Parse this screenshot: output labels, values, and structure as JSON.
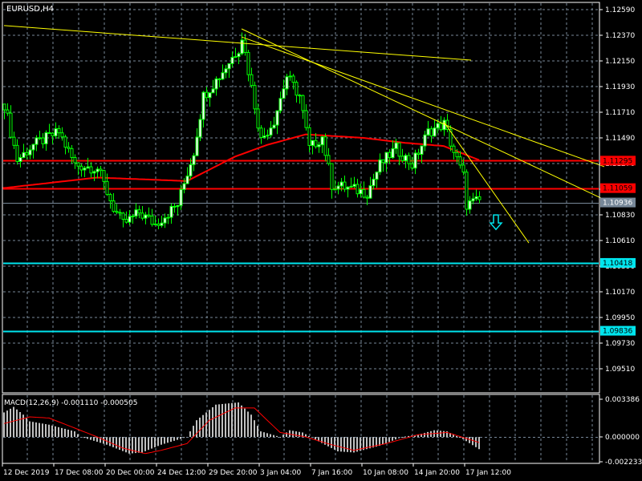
{
  "chart_title": "EURUSD,H4",
  "macd_label": "MACD(12,26,9) -0.001110 -0.000505",
  "colors": {
    "background": "#000000",
    "grid": "#778899",
    "candle": "#00ff00",
    "bull_body": "#ffffff",
    "bear_body": "#000000",
    "ma": "#ff0000",
    "trend": "#ffff00",
    "support": "#00e5ee",
    "current": "#778899",
    "macd_hist": "#c0c0c0",
    "macd_signal": "#ff0000"
  },
  "price_axis": {
    "ticks": [
      "1.12590",
      "1.12370",
      "1.12150",
      "1.11930",
      "1.11710",
      "1.11490",
      "1.11270",
      "1.11050",
      "1.10830",
      "1.10610",
      "1.10390",
      "1.10170",
      "1.09950",
      "1.09730",
      "1.09510"
    ],
    "tick_values": [
      1.1259,
      1.1237,
      1.1215,
      1.1193,
      1.1171,
      1.1149,
      1.1127,
      1.1105,
      1.1083,
      1.1061,
      1.1039,
      1.1017,
      1.0995,
      1.0973,
      1.0951
    ]
  },
  "levels": [
    {
      "label": "1.11295",
      "value": 1.11295,
      "type": "resistance",
      "color": "#ff0000"
    },
    {
      "label": "1.11059",
      "value": 1.11059,
      "type": "resistance",
      "color": "#ff0000"
    },
    {
      "label": "1.10936",
      "value": 1.10936,
      "type": "current-bid",
      "color": "#778899"
    },
    {
      "label": "1.10418",
      "value": 1.10418,
      "type": "support",
      "color": "#00e5ee"
    },
    {
      "label": "1.09836",
      "value": 1.09836,
      "type": "support",
      "color": "#00e5ee"
    }
  ],
  "time_axis": [
    "12 Dec 2019",
    "17 Dec 08:00",
    "20 Dec 00:00",
    "24 Dec 12:00",
    "29 Dec 20:00",
    "3 Jan 04:00",
    "7 Jan 16:00",
    "10 Jan 08:00",
    "14 Jan 20:00",
    "17 Jan 12:00"
  ],
  "macd_axis": {
    "ticks": [
      "0.003386",
      "0.000000",
      "-0.002233"
    ],
    "tick_values": [
      0.003386,
      0,
      -0.002233
    ]
  },
  "chart_data": {
    "type": "candlestick",
    "symbol": "EURUSD",
    "timeframe": "H4",
    "ylim": [
      1.094,
      1.1265
    ],
    "bars_count": 149,
    "close_anchors": [
      [
        0,
        1.1178
      ],
      [
        4,
        1.113
      ],
      [
        9,
        1.1143
      ],
      [
        17,
        1.1154
      ],
      [
        22,
        1.1126
      ],
      [
        29,
        1.1123
      ],
      [
        34,
        1.1089
      ],
      [
        37,
        1.1075
      ],
      [
        42,
        1.1085
      ],
      [
        47,
        1.1075
      ],
      [
        54,
        1.1092
      ],
      [
        59,
        1.1137
      ],
      [
        62,
        1.1185
      ],
      [
        67,
        1.1202
      ],
      [
        73,
        1.1226
      ],
      [
        74,
        1.1236
      ],
      [
        77,
        1.1192
      ],
      [
        80,
        1.1147
      ],
      [
        84,
        1.1164
      ],
      [
        88,
        1.1202
      ],
      [
        92,
        1.1185
      ],
      [
        95,
        1.114
      ],
      [
        99,
        1.115
      ],
      [
        102,
        1.1109
      ],
      [
        107,
        1.1106
      ],
      [
        113,
        1.1102
      ],
      [
        117,
        1.1126
      ],
      [
        122,
        1.114
      ],
      [
        127,
        1.1126
      ],
      [
        132,
        1.1154
      ],
      [
        137,
        1.1161
      ],
      [
        140,
        1.1137
      ],
      [
        143,
        1.1116
      ],
      [
        144,
        1.1092
      ],
      [
        148,
        1.1095
      ]
    ],
    "moving_average": [
      [
        0,
        1.1106
      ],
      [
        29,
        1.1115
      ],
      [
        57,
        1.1112
      ],
      [
        72,
        1.1133
      ],
      [
        82,
        1.1143
      ],
      [
        94,
        1.1152
      ],
      [
        112,
        1.1149
      ],
      [
        124,
        1.1145
      ],
      [
        137,
        1.1142
      ],
      [
        148,
        1.113
      ]
    ],
    "trend_lines": [
      [
        [
          0,
          1.12453
        ],
        [
          145.5,
          1.12157
        ]
      ],
      [
        [
          74,
          1.12356
        ],
        [
          187,
          1.11243
        ]
      ],
      [
        [
          74,
          1.12425
        ],
        [
          186,
          1.10974
        ]
      ],
      [
        [
          137,
          1.11628
        ],
        [
          163.5,
          1.10589
        ]
      ]
    ],
    "signal_arrow": {
      "direction": "down",
      "bar": 153,
      "price": 1.1076
    },
    "macd": {
      "ylim": [
        -0.002233,
        0.003386
      ],
      "histogram": [
        [
          0,
          0.0022
        ],
        [
          3,
          0.0027
        ],
        [
          6,
          0.002
        ],
        [
          8,
          0.0014
        ],
        [
          14,
          0.0011
        ],
        [
          22,
          0.0005
        ],
        [
          24,
          0
        ],
        [
          32,
          -0.0007
        ],
        [
          39,
          -0.0015
        ],
        [
          43,
          -0.0014
        ],
        [
          49,
          -0.0007
        ],
        [
          57,
          0
        ],
        [
          60,
          0.0015
        ],
        [
          66,
          0.0029
        ],
        [
          73,
          0.0031
        ],
        [
          77,
          0.002
        ],
        [
          80,
          0.0005
        ],
        [
          86,
          0
        ],
        [
          89,
          0.0006
        ],
        [
          93,
          0.0004
        ],
        [
          98,
          -0.0004
        ],
        [
          104,
          -0.0013
        ],
        [
          109,
          -0.0014
        ],
        [
          117,
          -0.0008
        ],
        [
          124,
          0
        ],
        [
          129,
          0.0002
        ],
        [
          134,
          0.0006
        ],
        [
          138,
          0.0005
        ],
        [
          143,
          -0.0002
        ],
        [
          148,
          -0.0011
        ]
      ],
      "signal": [
        [
          0,
          0.0012
        ],
        [
          8,
          0.0018
        ],
        [
          14,
          0.0017
        ],
        [
          22,
          0.0008
        ],
        [
          29,
          0
        ],
        [
          37,
          -0.001
        ],
        [
          44,
          -0.0015
        ],
        [
          49,
          -0.0012
        ],
        [
          57,
          -0.0006
        ],
        [
          64,
          0.0015
        ],
        [
          72,
          0.0026
        ],
        [
          78,
          0.0026
        ],
        [
          86,
          0.0004
        ],
        [
          94,
          0
        ],
        [
          102,
          -0.0007
        ],
        [
          109,
          -0.0012
        ],
        [
          119,
          -0.0006
        ],
        [
          129,
          0.0002
        ],
        [
          138,
          0.0004
        ],
        [
          148,
          -0.0005
        ]
      ]
    }
  }
}
